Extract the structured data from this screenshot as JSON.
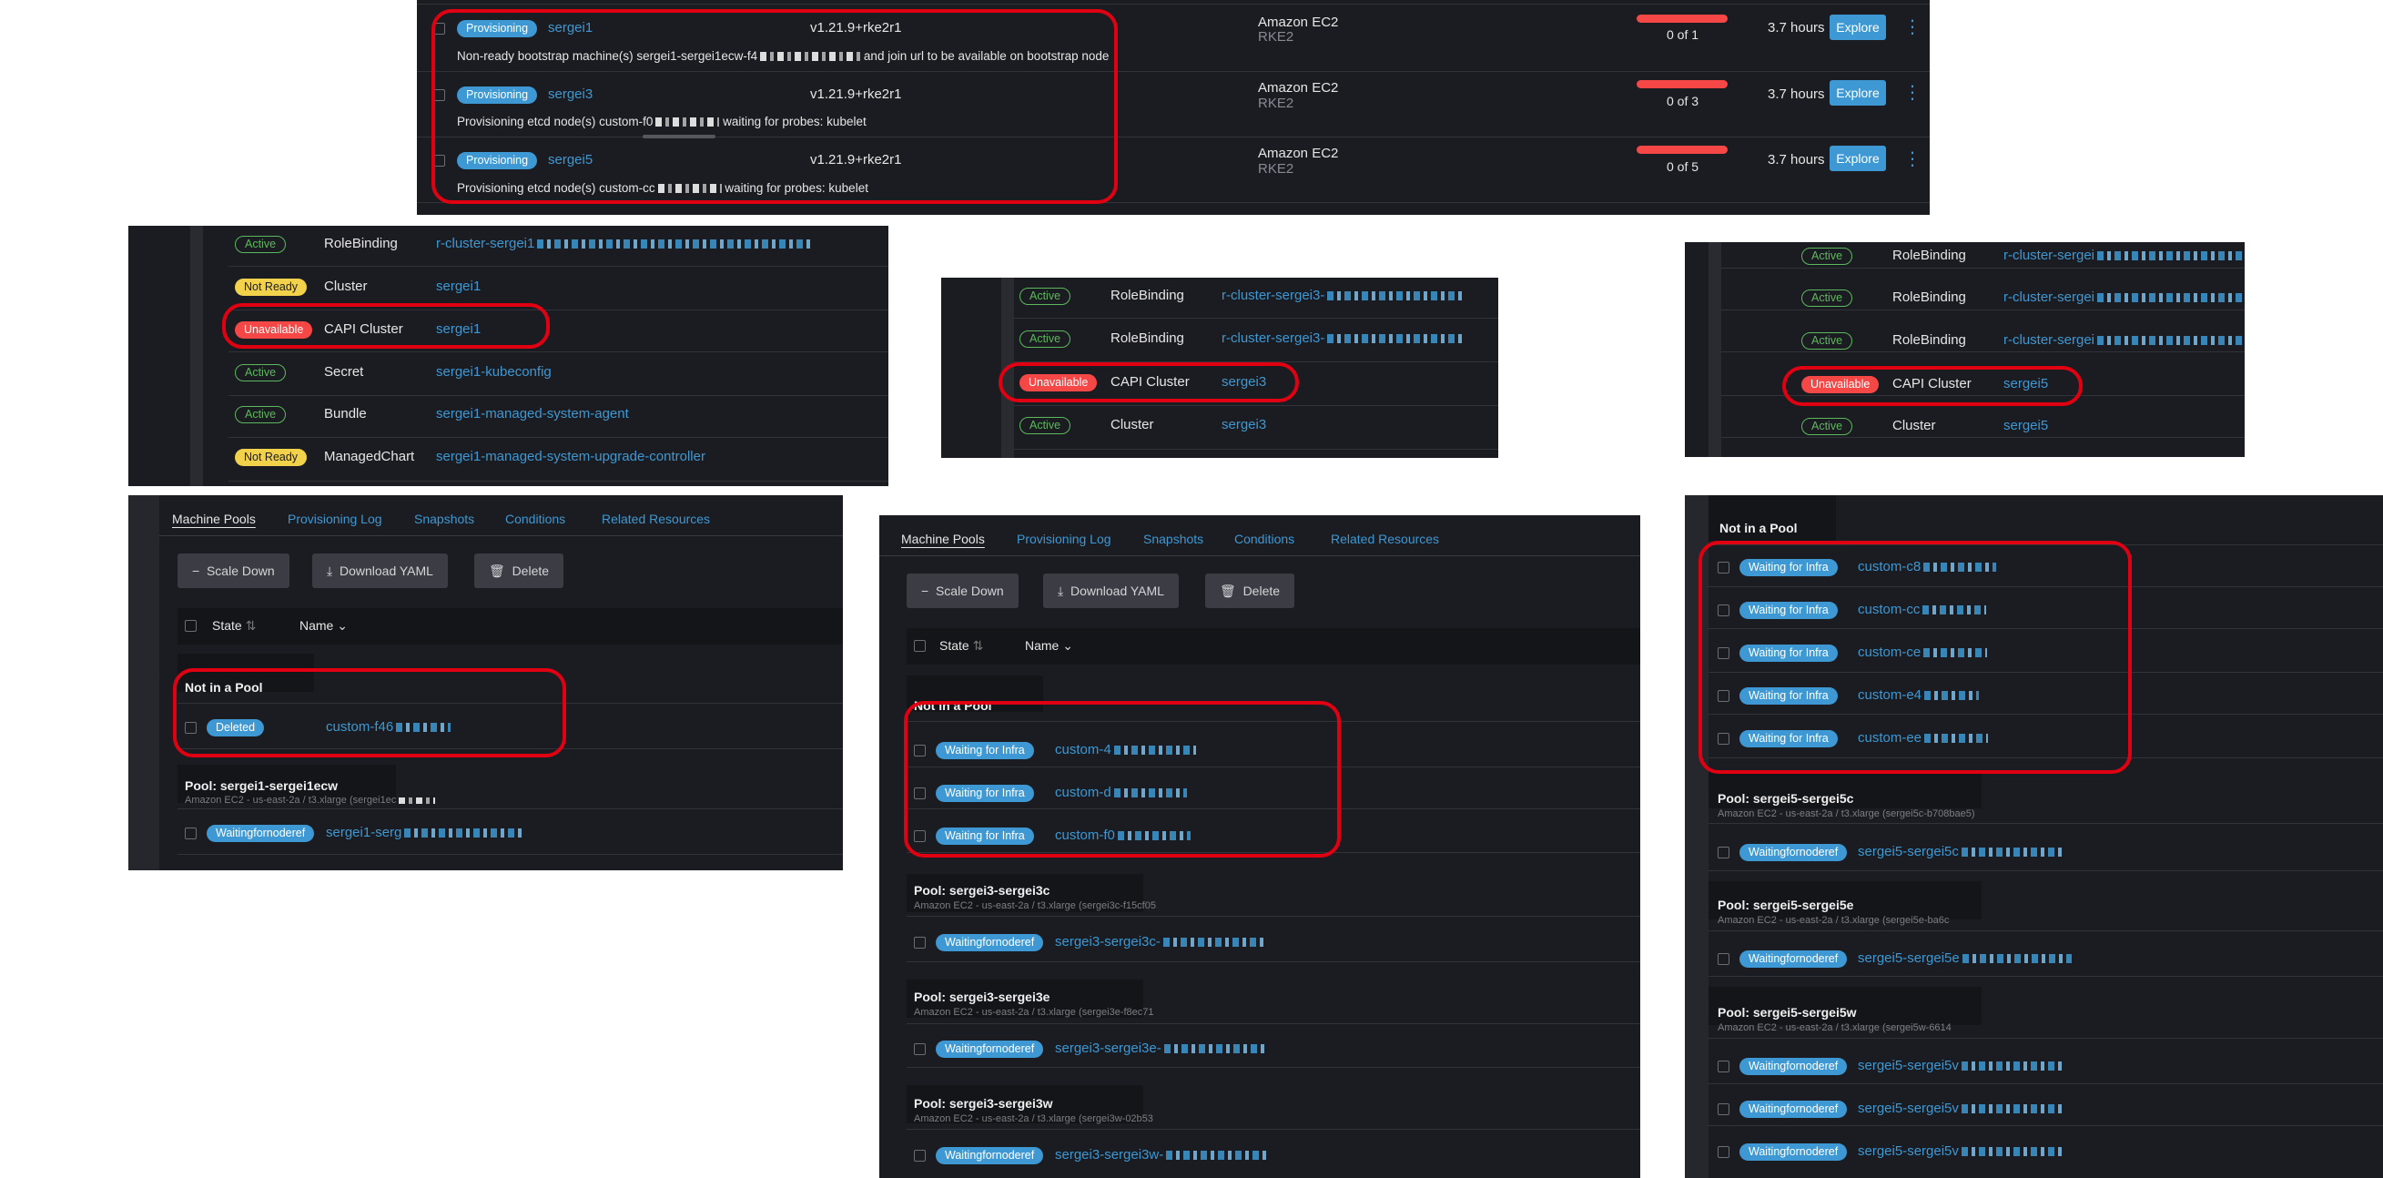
{
  "clusters_panel": {
    "rows": [
      {
        "state": "Provisioning",
        "name": "sergei1",
        "message": "Non-ready bootstrap machine(s) sergei1-sergei1ecw-f4",
        "message_tail": "and join url to be available on bootstrap node",
        "version": "v1.21.9+rke2r1",
        "provider": "Amazon EC2",
        "distro": "RKE2",
        "machines": "0 of 1",
        "age": "3.7 hours",
        "action": "Explore"
      },
      {
        "state": "Provisioning",
        "name": "sergei3",
        "message": "Provisioning etcd node(s) custom-f0",
        "message_tail": "waiting for probes: kubelet",
        "version": "v1.21.9+rke2r1",
        "provider": "Amazon EC2",
        "distro": "RKE2",
        "machines": "0 of 3",
        "age": "3.7 hours",
        "action": "Explore"
      },
      {
        "state": "Provisioning",
        "name": "sergei5",
        "message": "Provisioning etcd node(s) custom-cc",
        "message_tail": "waiting for probes: kubelet",
        "version": "v1.21.9+rke2r1",
        "provider": "Amazon EC2",
        "distro": "RKE2",
        "machines": "0 of 5",
        "age": "3.7 hours",
        "action": "Explore"
      }
    ]
  },
  "resources_a": {
    "rows": [
      {
        "state": "Active",
        "type": "RoleBinding",
        "name": "r-cluster-sergei1"
      },
      {
        "state": "Not Ready",
        "type": "Cluster",
        "name": "sergei1"
      },
      {
        "state": "Unavailable",
        "type": "CAPI Cluster",
        "name": "sergei1"
      },
      {
        "state": "Active",
        "type": "Secret",
        "name": "sergei1-kubeconfig"
      },
      {
        "state": "Active",
        "type": "Bundle",
        "name": "sergei1-managed-system-agent"
      },
      {
        "state": "Not Ready",
        "type": "ManagedChart",
        "name": "sergei1-managed-system-upgrade-controller"
      }
    ]
  },
  "resources_b": {
    "rows": [
      {
        "state": "Active",
        "type": "RoleBinding",
        "name": "r-cluster-sergei3-"
      },
      {
        "state": "Active",
        "type": "RoleBinding",
        "name": "r-cluster-sergei3-"
      },
      {
        "state": "Unavailable",
        "type": "CAPI Cluster",
        "name": "sergei3"
      },
      {
        "state": "Active",
        "type": "Cluster",
        "name": "sergei3"
      }
    ]
  },
  "resources_c": {
    "rows": [
      {
        "state": "Active",
        "type": "RoleBinding",
        "name": "r-cluster-sergei"
      },
      {
        "state": "Active",
        "type": "RoleBinding",
        "name": "r-cluster-sergei"
      },
      {
        "state": "Active",
        "type": "RoleBinding",
        "name": "r-cluster-sergei"
      },
      {
        "state": "Unavailable",
        "type": "CAPI Cluster",
        "name": "sergei5"
      },
      {
        "state": "Active",
        "type": "Cluster",
        "name": "sergei5"
      }
    ]
  },
  "detail": {
    "tabs": [
      "Machine Pools",
      "Provisioning Log",
      "Snapshots",
      "Conditions",
      "Related Resources"
    ],
    "buttons": {
      "scale_down": "Scale Down",
      "download_yaml": "Download YAML",
      "delete": "Delete"
    },
    "columns": {
      "state": "State",
      "name": "Name"
    },
    "not_in_pool": "Not in a Pool"
  },
  "pools_a": {
    "not_in_pool_rows": [
      {
        "state": "Deleted",
        "name": "custom-f46"
      }
    ],
    "pools": [
      {
        "title": "Pool: sergei1-sergei1ecw",
        "sub": "Amazon EC2 - us-east-2a / t3.xlarge (sergei1ec",
        "machines": [
          {
            "state": "Waitingfornoderef",
            "name": "sergei1-serg"
          }
        ]
      }
    ]
  },
  "pools_b": {
    "not_in_pool_rows": [
      {
        "state": "Waiting for Infra",
        "name": "custom-4"
      },
      {
        "state": "Waiting for Infra",
        "name": "custom-d"
      },
      {
        "state": "Waiting for Infra",
        "name": "custom-f0"
      }
    ],
    "pools": [
      {
        "title": "Pool: sergei3-sergei3c",
        "sub": "Amazon EC2 - us-east-2a / t3.xlarge (sergei3c-f15cf05",
        "machines": [
          {
            "state": "Waitingfornoderef",
            "name": "sergei3-sergei3c-"
          }
        ]
      },
      {
        "title": "Pool: sergei3-sergei3e",
        "sub": "Amazon EC2 - us-east-2a / t3.xlarge (sergei3e-f8ec71",
        "machines": [
          {
            "state": "Waitingfornoderef",
            "name": "sergei3-sergei3e-"
          }
        ]
      },
      {
        "title": "Pool: sergei3-sergei3w",
        "sub": "Amazon EC2 - us-east-2a / t3.xlarge (sergei3w-02b53",
        "machines": [
          {
            "state": "Waitingfornoderef",
            "name": "sergei3-sergei3w-"
          }
        ]
      }
    ]
  },
  "pools_c": {
    "not_in_pool_rows": [
      {
        "state": "Waiting for Infra",
        "name": "custom-c8"
      },
      {
        "state": "Waiting for Infra",
        "name": "custom-cc"
      },
      {
        "state": "Waiting for Infra",
        "name": "custom-ce"
      },
      {
        "state": "Waiting for Infra",
        "name": "custom-e4"
      },
      {
        "state": "Waiting for Infra",
        "name": "custom-ee"
      }
    ],
    "pools": [
      {
        "title": "Pool: sergei5-sergei5c",
        "sub": "Amazon EC2 - us-east-2a / t3.xlarge (sergei5c-b708bae5)",
        "machines": [
          {
            "state": "Waitingfornoderef",
            "name": "sergei5-sergei5c"
          }
        ]
      },
      {
        "title": "Pool: sergei5-sergei5e",
        "sub": "Amazon EC2 - us-east-2a / t3.xlarge (sergei5e-ba6c",
        "machines": [
          {
            "state": "Waitingfornoderef",
            "name": "sergei5-sergei5e"
          }
        ]
      },
      {
        "title": "Pool: sergei5-sergei5w",
        "sub": "Amazon EC2 - us-east-2a / t3.xlarge (sergei5w-6614",
        "machines": [
          {
            "state": "Waitingfornoderef",
            "name": "sergei5-sergei5v"
          },
          {
            "state": "Waitingfornoderef",
            "name": "sergei5-sergei5v"
          },
          {
            "state": "Waitingfornoderef",
            "name": "sergei5-sergei5v"
          }
        ]
      }
    ]
  },
  "colors": {
    "accent": "#3d98d3",
    "danger": "#f64747",
    "warning": "#f2d24a",
    "success": "#5cb85c",
    "highlight": "#e00012",
    "background": "#1b1c21"
  },
  "icons": {
    "checkbox": "checkbox-icon",
    "kebab": "kebab-menu-icon",
    "sort": "sort-icon",
    "scale_down": "minus-icon",
    "download": "download-icon",
    "delete": "trash-icon"
  }
}
